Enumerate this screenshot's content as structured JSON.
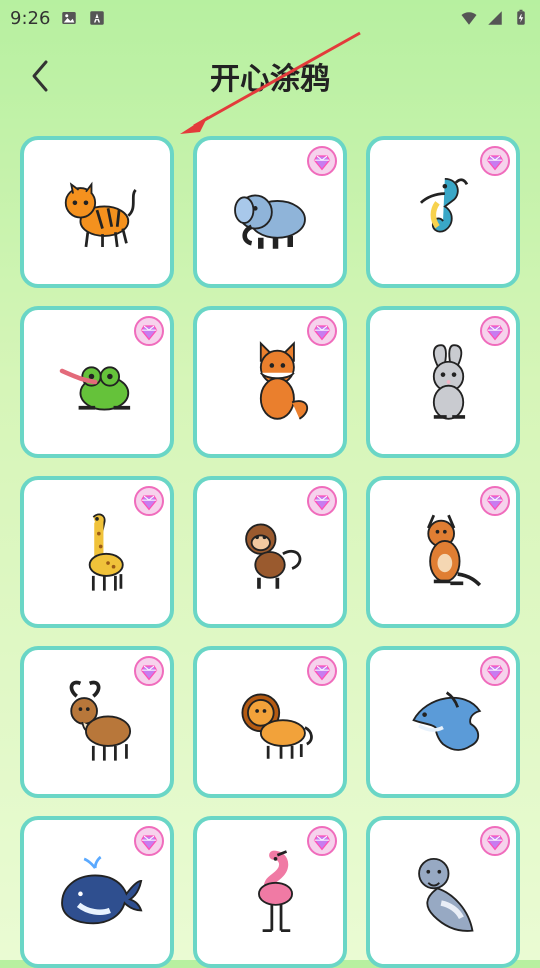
{
  "status_bar": {
    "time": "9:26"
  },
  "header": {
    "title": "开心涂鸦"
  },
  "grid": {
    "items": [
      {
        "name": "tiger",
        "premium": false,
        "color": "#f4911e",
        "accent": "#222"
      },
      {
        "name": "elephant",
        "premium": true,
        "color": "#8fb4d9",
        "accent": "#222"
      },
      {
        "name": "seahorse",
        "premium": true,
        "color": "#3aa7c7",
        "accent": "#f7d24d"
      },
      {
        "name": "frog",
        "premium": true,
        "color": "#65c23a",
        "accent": "#e36a7a"
      },
      {
        "name": "fox",
        "premium": true,
        "color": "#ea7f2d",
        "accent": "#fff"
      },
      {
        "name": "rabbit",
        "premium": true,
        "color": "#c9cbd0",
        "accent": "#f5b5c6"
      },
      {
        "name": "giraffe",
        "premium": true,
        "color": "#f0c23a",
        "accent": "#9b5b16"
      },
      {
        "name": "monkey",
        "premium": true,
        "color": "#9a5a2e",
        "accent": "#f1c9a0"
      },
      {
        "name": "kangaroo",
        "premium": true,
        "color": "#e07e33",
        "accent": "#f5d7b3"
      },
      {
        "name": "goat",
        "premium": true,
        "color": "#b8773a",
        "accent": "#f2e2c7"
      },
      {
        "name": "lion",
        "premium": true,
        "color": "#f2a23a",
        "accent": "#b45a12"
      },
      {
        "name": "dolphin",
        "premium": true,
        "color": "#5b9bd8",
        "accent": "#e7f1fb"
      },
      {
        "name": "whale",
        "premium": true,
        "color": "#2f4f8f",
        "accent": "#e8f3ff"
      },
      {
        "name": "flamingo",
        "premium": true,
        "color": "#f07aa4",
        "accent": "#222"
      },
      {
        "name": "seal",
        "premium": true,
        "color": "#97a9c3",
        "accent": "#e9eef7"
      }
    ]
  }
}
